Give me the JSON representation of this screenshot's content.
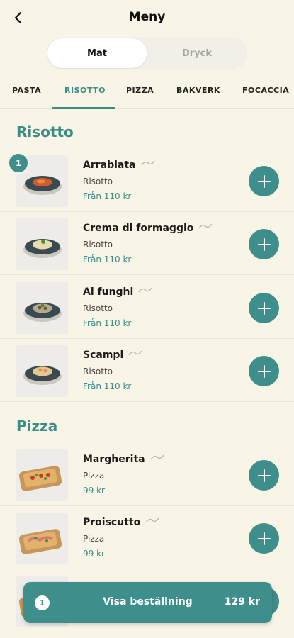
{
  "header": {
    "title": "Meny"
  },
  "segment": {
    "options": [
      "Mat",
      "Dryck"
    ],
    "selected": "Mat"
  },
  "tabs": [
    {
      "label": "PASTA"
    },
    {
      "label": "RISOTTO"
    },
    {
      "label": "PIZZA"
    },
    {
      "label": "BAKVERK"
    },
    {
      "label": "FOCACCIA"
    }
  ],
  "active_tab": "RISOTTO",
  "sections": [
    {
      "title": "Risotto",
      "items": [
        {
          "name": "Arrabiata",
          "category": "Risotto",
          "price": "Från 110 kr",
          "quantity": "1",
          "icon": "vegan-icon"
        },
        {
          "name": "Crema di formaggio",
          "category": "Risotto",
          "price": "Från 110 kr",
          "icon": "vegan-icon"
        },
        {
          "name": "Al funghi",
          "category": "Risotto",
          "price": "Från 110 kr",
          "icon": "vegan-icon"
        },
        {
          "name": "Scampi",
          "category": "Risotto",
          "price": "Från 110 kr",
          "icon": "vegan-icon"
        }
      ]
    },
    {
      "title": "Pizza",
      "items": [
        {
          "name": "Margherita",
          "category": "Pizza",
          "price": "99 kr",
          "icon": "vegan-icon"
        },
        {
          "name": "Proiscutto",
          "category": "Pizza",
          "price": "99 kr",
          "icon": "vegan-icon"
        }
      ]
    }
  ],
  "order_bar": {
    "count": "1",
    "label": "Visa beställning",
    "total": "129 kr"
  },
  "colors": {
    "accent": "#3e8e8b",
    "background": "#f9f5e6"
  }
}
